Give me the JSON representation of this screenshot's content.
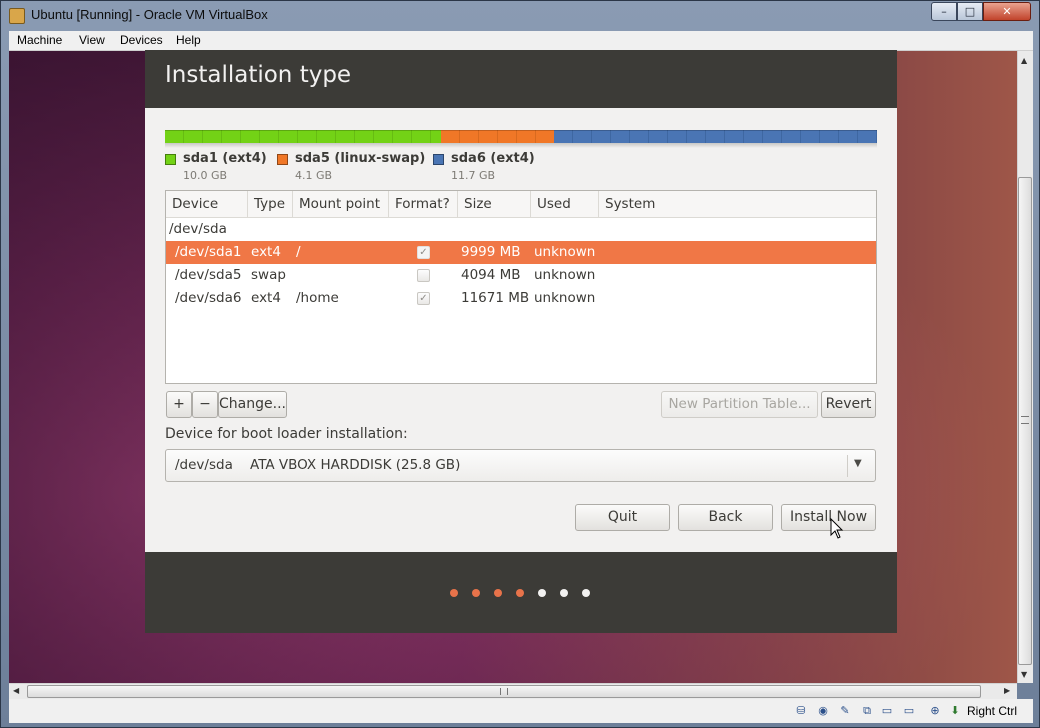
{
  "window": {
    "title": "Ubuntu [Running] - Oracle VM VirtualBox",
    "menu": [
      "Machine",
      "View",
      "Devices",
      "Help"
    ],
    "controls": {
      "minimize": "–",
      "maximize": "□",
      "close": "✕"
    }
  },
  "installer": {
    "title": "Installation type",
    "partitions": [
      {
        "name": "sda1 (ext4)",
        "size": "10.0 GB",
        "color": "#73d216"
      },
      {
        "name": "sda5 (linux-swap)",
        "size": "4.1 GB",
        "color": "#f07727"
      },
      {
        "name": "sda6 (ext4)",
        "size": "11.7 GB",
        "color": "#4a75b4"
      }
    ],
    "table": {
      "headers": [
        "Device",
        "Type",
        "Mount point",
        "Format?",
        "Size",
        "Used",
        "System"
      ],
      "disk": "/dev/sda",
      "rows": [
        {
          "device": "/dev/sda1",
          "type": "ext4",
          "mount": "/",
          "format": true,
          "size": "9999 MB",
          "used": "unknown",
          "selected": true
        },
        {
          "device": "/dev/sda5",
          "type": "swap",
          "mount": "",
          "format": false,
          "size": "4094 MB",
          "used": "unknown",
          "selected": false
        },
        {
          "device": "/dev/sda6",
          "type": "ext4",
          "mount": "/home",
          "format": true,
          "size": "11671 MB",
          "used": "unknown",
          "selected": false
        }
      ]
    },
    "buttons": {
      "add": "+",
      "remove": "−",
      "change": "Change...",
      "new_table": "New Partition Table...",
      "revert": "Revert",
      "quit": "Quit",
      "back": "Back",
      "install": "Install Now"
    },
    "bootloader": {
      "label": "Device for boot loader installation:",
      "value": "/dev/sda    ATA VBOX HARDDISK (25.8 GB)"
    },
    "progress_dots": {
      "total": 7,
      "completed": 4
    }
  },
  "statusbar": {
    "host_key": "Right Ctrl"
  }
}
